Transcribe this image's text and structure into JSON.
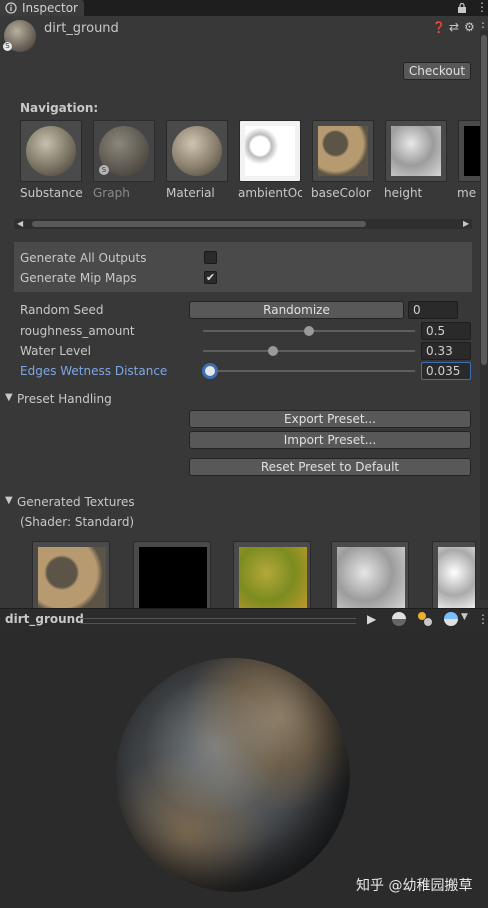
{
  "tab": {
    "label": "Inspector"
  },
  "header": {
    "title": "dirt_ground"
  },
  "toolbar": {
    "checkout_label": "Checkout"
  },
  "navigation": {
    "title": "Navigation:",
    "items": [
      {
        "label": "Substance"
      },
      {
        "label": "Graph"
      },
      {
        "label": "Material"
      },
      {
        "label": "ambientOcc"
      },
      {
        "label": "baseColor"
      },
      {
        "label": "height"
      },
      {
        "label": "me"
      }
    ]
  },
  "options": {
    "generate_all_outputs": {
      "label": "Generate All Outputs",
      "checked": false
    },
    "generate_mip_maps": {
      "label": "Generate Mip Maps",
      "checked": true
    }
  },
  "params": {
    "random_seed": {
      "label": "Random Seed",
      "button": "Randomize",
      "value": "0"
    },
    "roughness_amount": {
      "label": "roughness_amount",
      "value": "0.5",
      "level": 0.5
    },
    "water_level": {
      "label": "Water Level",
      "value": "0.33",
      "level": 0.33
    },
    "edges_wetness": {
      "label": "Edges Wetness Distance",
      "value": "0.035",
      "level": 0.035
    }
  },
  "preset": {
    "title": "Preset Handling",
    "export_label": "Export Preset...",
    "import_label": "Import Preset...",
    "reset_label": "Reset Preset to Default"
  },
  "generated": {
    "title": "Generated Textures",
    "shader": "(Shader: Standard)"
  },
  "preview": {
    "title": "dirt_ground"
  },
  "watermark": "知乎 @幼稚园搬草",
  "colors": {
    "accent": "#7ea7e6",
    "field_bg": "#2a2a2a",
    "panel_bg": "#383838"
  }
}
